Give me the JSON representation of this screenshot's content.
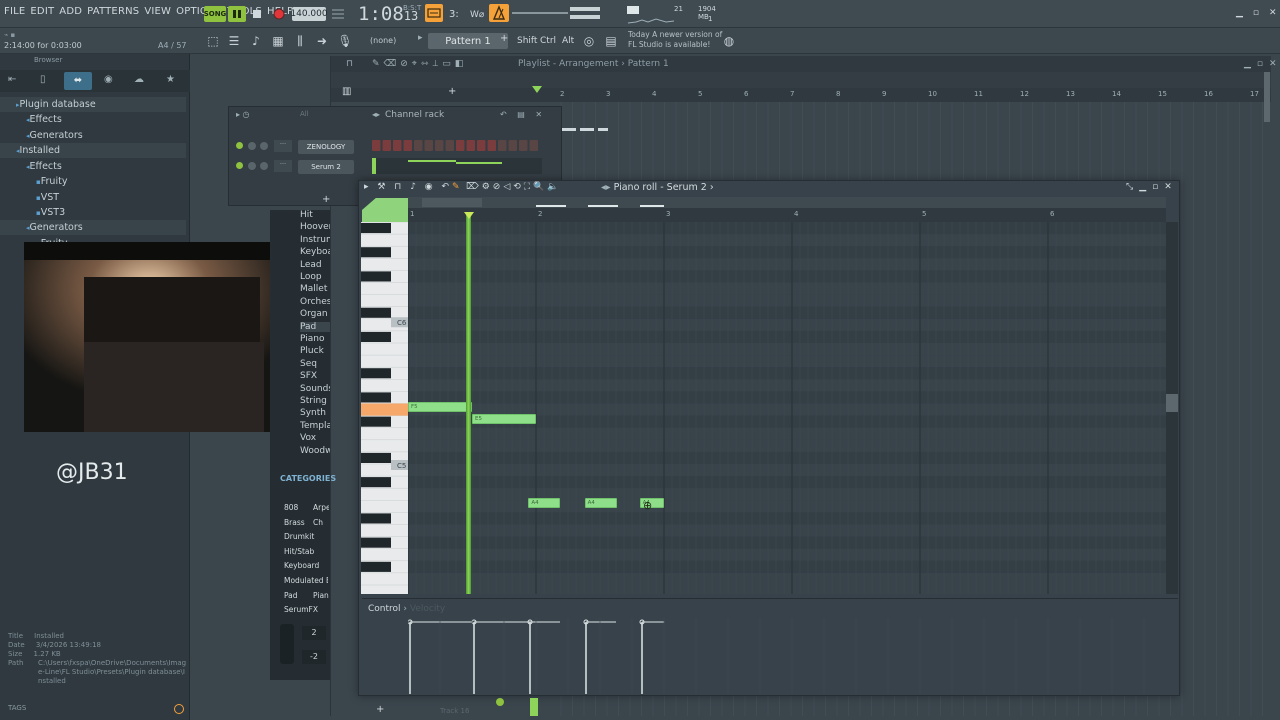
{
  "menu": [
    "FILE",
    "EDIT",
    "ADD",
    "PATTERNS",
    "VIEW",
    "OPTIONS",
    "TOOLS",
    "HELP"
  ],
  "transport": {
    "song_label": "SONG",
    "tempo": "140.000",
    "time": "1:08",
    "time_frac": "13",
    "time_unit": "B:S:T"
  },
  "cpu": {
    "value": "21",
    "memory": "1904 MB",
    "voices": "1"
  },
  "hint_bar": {
    "text": "2:14:00 for 0:03:00",
    "count": "A4 / 57"
  },
  "toolbar": {
    "none_select": "(none)",
    "pattern": "Pattern 1",
    "shift": "Shift",
    "ctrl": "Ctrl",
    "alt": "Alt",
    "news_line1": "Today  A newer version of",
    "news_line2": "FL Studio is available!"
  },
  "browser": {
    "title": "Browser",
    "items": [
      {
        "label": "Plugin database",
        "indent": 1
      },
      {
        "label": "Effects",
        "indent": 2
      },
      {
        "label": "Generators",
        "indent": 2
      },
      {
        "label": "Installed",
        "indent": 1
      },
      {
        "label": "Effects",
        "indent": 2
      },
      {
        "label": "Fruity",
        "indent": 3
      },
      {
        "label": "VST",
        "indent": 3
      },
      {
        "label": "VST3",
        "indent": 3
      },
      {
        "label": "Generators",
        "indent": 2
      },
      {
        "label": "Fruity",
        "indent": 3
      }
    ],
    "info": {
      "title_label": "Title",
      "title": "Installed",
      "date_label": "Date",
      "date": "3/4/2026 13:49:18",
      "size_label": "Size",
      "size": "1.27 KB",
      "path_label": "Path",
      "path": "C:\\Users\\fxspa\\OneDrive\\Documents\\Image-Line\\FL Studio\\Presets\\Plugin database\\Installed"
    },
    "tags_label": "TAGS"
  },
  "overlay": {
    "handle": "@JB31"
  },
  "serum_categories": [
    "Hit",
    "Hoover",
    "Instrum",
    "Keyboa",
    "Lead",
    "Loop",
    "Mallet",
    "Orchest",
    "Organ",
    "Pad",
    "Piano",
    "Pluck",
    "Seq",
    "SFX",
    "Sounds",
    "String",
    "Synth",
    "Templa",
    "Vox",
    "Woodw"
  ],
  "categories_panel": {
    "title": "CATEGORIES",
    "rows": [
      [
        "808",
        "Arpe"
      ],
      [
        "Brass",
        "Ch"
      ],
      [
        "Drumkit",
        ""
      ],
      [
        "Hit/Stab",
        ""
      ],
      [
        "Keyboard",
        ""
      ],
      [
        "Modulated Ba",
        ""
      ],
      [
        "Pad",
        "Piano"
      ],
      [
        "SerumFX",
        ""
      ]
    ],
    "values": [
      "2",
      "-2"
    ]
  },
  "playlist": {
    "title": "Playlist - Arrangement",
    "pattern": "Pattern 1",
    "bars": [
      "2",
      "3",
      "4",
      "5",
      "6",
      "7",
      "8",
      "9",
      "10",
      "11",
      "12",
      "13",
      "14",
      "15",
      "16",
      "17"
    ],
    "track": "Track 16"
  },
  "channel_rack": {
    "title": "Channel rack",
    "filter": "All",
    "channels": [
      "ZENOLOGY",
      "Serum 2"
    ]
  },
  "piano_roll": {
    "title": "Piano roll - Serum 2",
    "bars": [
      "1",
      "2",
      "3",
      "4",
      "5",
      "6"
    ],
    "key_labels": [
      "C6",
      "C5"
    ],
    "notes": [
      {
        "label": "F5",
        "row": 15,
        "start": 0,
        "len": 0.5
      },
      {
        "label": "E5",
        "row": 16,
        "start": 0.5,
        "len": 0.5
      },
      {
        "label": "A4",
        "row": 23,
        "start": 0.94,
        "len": 0.25
      },
      {
        "label": "A4",
        "row": 23,
        "start": 1.38,
        "len": 0.25
      },
      {
        "label": "A4",
        "row": 23,
        "start": 1.81,
        "len": 0.19
      }
    ],
    "control_label": "Control",
    "control_target": "Velocity"
  },
  "colors": {
    "note": "#8fdf8a",
    "playhead": "#8ed45a",
    "accent_orange": "#f5a13a"
  }
}
